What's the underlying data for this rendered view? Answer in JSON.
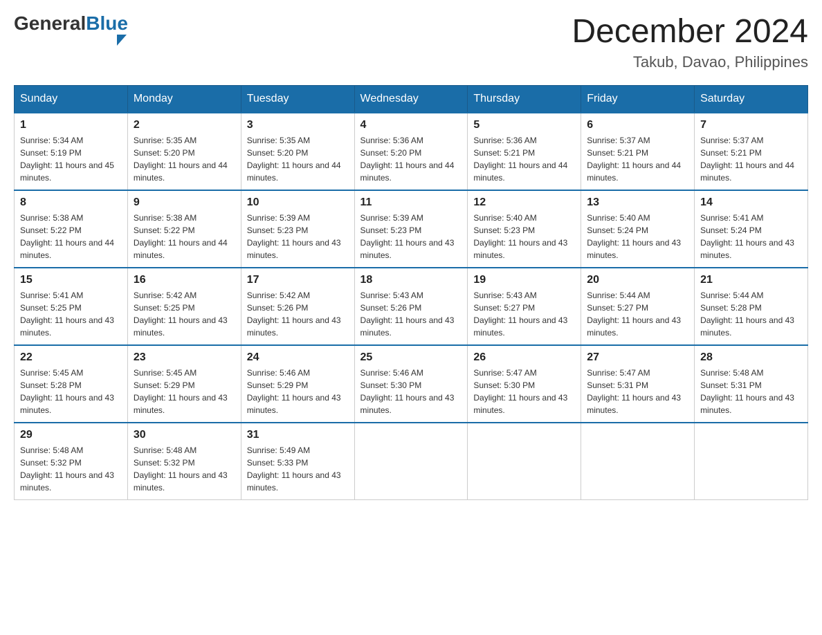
{
  "header": {
    "logo": {
      "general": "General",
      "blue": "Blue",
      "alt": "GeneralBlue logo"
    },
    "month_year": "December 2024",
    "location": "Takub, Davao, Philippines"
  },
  "days_of_week": [
    "Sunday",
    "Monday",
    "Tuesday",
    "Wednesday",
    "Thursday",
    "Friday",
    "Saturday"
  ],
  "weeks": [
    [
      {
        "day": "1",
        "sunrise": "Sunrise: 5:34 AM",
        "sunset": "Sunset: 5:19 PM",
        "daylight": "Daylight: 11 hours and 45 minutes."
      },
      {
        "day": "2",
        "sunrise": "Sunrise: 5:35 AM",
        "sunset": "Sunset: 5:20 PM",
        "daylight": "Daylight: 11 hours and 44 minutes."
      },
      {
        "day": "3",
        "sunrise": "Sunrise: 5:35 AM",
        "sunset": "Sunset: 5:20 PM",
        "daylight": "Daylight: 11 hours and 44 minutes."
      },
      {
        "day": "4",
        "sunrise": "Sunrise: 5:36 AM",
        "sunset": "Sunset: 5:20 PM",
        "daylight": "Daylight: 11 hours and 44 minutes."
      },
      {
        "day": "5",
        "sunrise": "Sunrise: 5:36 AM",
        "sunset": "Sunset: 5:21 PM",
        "daylight": "Daylight: 11 hours and 44 minutes."
      },
      {
        "day": "6",
        "sunrise": "Sunrise: 5:37 AM",
        "sunset": "Sunset: 5:21 PM",
        "daylight": "Daylight: 11 hours and 44 minutes."
      },
      {
        "day": "7",
        "sunrise": "Sunrise: 5:37 AM",
        "sunset": "Sunset: 5:21 PM",
        "daylight": "Daylight: 11 hours and 44 minutes."
      }
    ],
    [
      {
        "day": "8",
        "sunrise": "Sunrise: 5:38 AM",
        "sunset": "Sunset: 5:22 PM",
        "daylight": "Daylight: 11 hours and 44 minutes."
      },
      {
        "day": "9",
        "sunrise": "Sunrise: 5:38 AM",
        "sunset": "Sunset: 5:22 PM",
        "daylight": "Daylight: 11 hours and 44 minutes."
      },
      {
        "day": "10",
        "sunrise": "Sunrise: 5:39 AM",
        "sunset": "Sunset: 5:23 PM",
        "daylight": "Daylight: 11 hours and 43 minutes."
      },
      {
        "day": "11",
        "sunrise": "Sunrise: 5:39 AM",
        "sunset": "Sunset: 5:23 PM",
        "daylight": "Daylight: 11 hours and 43 minutes."
      },
      {
        "day": "12",
        "sunrise": "Sunrise: 5:40 AM",
        "sunset": "Sunset: 5:23 PM",
        "daylight": "Daylight: 11 hours and 43 minutes."
      },
      {
        "day": "13",
        "sunrise": "Sunrise: 5:40 AM",
        "sunset": "Sunset: 5:24 PM",
        "daylight": "Daylight: 11 hours and 43 minutes."
      },
      {
        "day": "14",
        "sunrise": "Sunrise: 5:41 AM",
        "sunset": "Sunset: 5:24 PM",
        "daylight": "Daylight: 11 hours and 43 minutes."
      }
    ],
    [
      {
        "day": "15",
        "sunrise": "Sunrise: 5:41 AM",
        "sunset": "Sunset: 5:25 PM",
        "daylight": "Daylight: 11 hours and 43 minutes."
      },
      {
        "day": "16",
        "sunrise": "Sunrise: 5:42 AM",
        "sunset": "Sunset: 5:25 PM",
        "daylight": "Daylight: 11 hours and 43 minutes."
      },
      {
        "day": "17",
        "sunrise": "Sunrise: 5:42 AM",
        "sunset": "Sunset: 5:26 PM",
        "daylight": "Daylight: 11 hours and 43 minutes."
      },
      {
        "day": "18",
        "sunrise": "Sunrise: 5:43 AM",
        "sunset": "Sunset: 5:26 PM",
        "daylight": "Daylight: 11 hours and 43 minutes."
      },
      {
        "day": "19",
        "sunrise": "Sunrise: 5:43 AM",
        "sunset": "Sunset: 5:27 PM",
        "daylight": "Daylight: 11 hours and 43 minutes."
      },
      {
        "day": "20",
        "sunrise": "Sunrise: 5:44 AM",
        "sunset": "Sunset: 5:27 PM",
        "daylight": "Daylight: 11 hours and 43 minutes."
      },
      {
        "day": "21",
        "sunrise": "Sunrise: 5:44 AM",
        "sunset": "Sunset: 5:28 PM",
        "daylight": "Daylight: 11 hours and 43 minutes."
      }
    ],
    [
      {
        "day": "22",
        "sunrise": "Sunrise: 5:45 AM",
        "sunset": "Sunset: 5:28 PM",
        "daylight": "Daylight: 11 hours and 43 minutes."
      },
      {
        "day": "23",
        "sunrise": "Sunrise: 5:45 AM",
        "sunset": "Sunset: 5:29 PM",
        "daylight": "Daylight: 11 hours and 43 minutes."
      },
      {
        "day": "24",
        "sunrise": "Sunrise: 5:46 AM",
        "sunset": "Sunset: 5:29 PM",
        "daylight": "Daylight: 11 hours and 43 minutes."
      },
      {
        "day": "25",
        "sunrise": "Sunrise: 5:46 AM",
        "sunset": "Sunset: 5:30 PM",
        "daylight": "Daylight: 11 hours and 43 minutes."
      },
      {
        "day": "26",
        "sunrise": "Sunrise: 5:47 AM",
        "sunset": "Sunset: 5:30 PM",
        "daylight": "Daylight: 11 hours and 43 minutes."
      },
      {
        "day": "27",
        "sunrise": "Sunrise: 5:47 AM",
        "sunset": "Sunset: 5:31 PM",
        "daylight": "Daylight: 11 hours and 43 minutes."
      },
      {
        "day": "28",
        "sunrise": "Sunrise: 5:48 AM",
        "sunset": "Sunset: 5:31 PM",
        "daylight": "Daylight: 11 hours and 43 minutes."
      }
    ],
    [
      {
        "day": "29",
        "sunrise": "Sunrise: 5:48 AM",
        "sunset": "Sunset: 5:32 PM",
        "daylight": "Daylight: 11 hours and 43 minutes."
      },
      {
        "day": "30",
        "sunrise": "Sunrise: 5:48 AM",
        "sunset": "Sunset: 5:32 PM",
        "daylight": "Daylight: 11 hours and 43 minutes."
      },
      {
        "day": "31",
        "sunrise": "Sunrise: 5:49 AM",
        "sunset": "Sunset: 5:33 PM",
        "daylight": "Daylight: 11 hours and 43 minutes."
      },
      {
        "day": "",
        "sunrise": "",
        "sunset": "",
        "daylight": ""
      },
      {
        "day": "",
        "sunrise": "",
        "sunset": "",
        "daylight": ""
      },
      {
        "day": "",
        "sunrise": "",
        "sunset": "",
        "daylight": ""
      },
      {
        "day": "",
        "sunrise": "",
        "sunset": "",
        "daylight": ""
      }
    ]
  ]
}
